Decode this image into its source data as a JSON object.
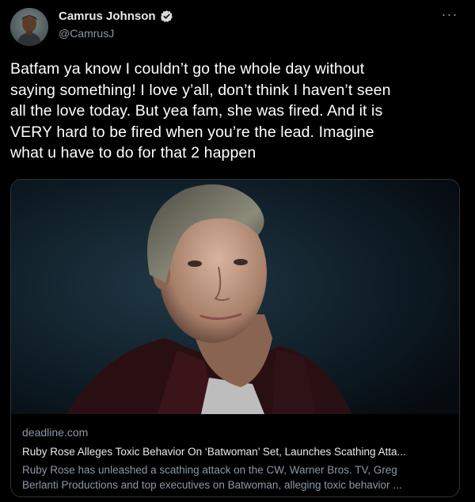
{
  "author": {
    "display_name": "Camrus Johnson",
    "handle": "@CamrusJ",
    "verified_icon": "verified-badge-icon"
  },
  "more_label": "···",
  "tweet": {
    "text": "Batfam ya know I couldn’t go the whole day without\nsaying something! I love y’all, don’t think I haven’t seen\nall the love today. But yea fam, she was fired. And it is\nVERY hard to be fired when you’re the lead. Imagine\nwhat u have to do for that 2 happen"
  },
  "card": {
    "domain": "deadline.com",
    "title": "Ruby Rose Alleges Toxic Behavior On ‘Batwoman’ Set, Launches Scathing Atta...",
    "description": "Ruby Rose has unleashed a scathing attack on the CW, Warner Bros. TV, Greg\nBerlanti Productions and top executives on Batwoman, alleging toxic behavior ..."
  },
  "colors": {
    "background": "#000000",
    "text_primary": "#e7e9ea",
    "text_secondary": "#8b98a5",
    "border": "#2f3336",
    "verified": "#d9d9d9"
  }
}
